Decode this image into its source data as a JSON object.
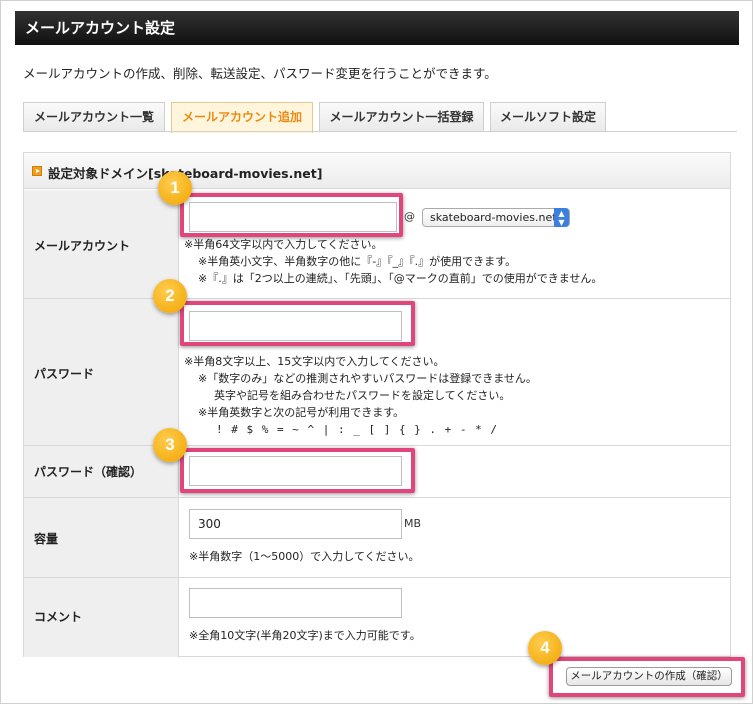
{
  "page": {
    "title": "メールアカウント設定",
    "description": "メールアカウントの作成、削除、転送設定、パスワード変更を行うことができます。"
  },
  "tabs": [
    {
      "label": "メールアカウント一覧",
      "active": false
    },
    {
      "label": "メールアカウント追加",
      "active": true
    },
    {
      "label": "メールアカウント一括登録",
      "active": false
    },
    {
      "label": "メールソフト設定",
      "active": false
    }
  ],
  "panel": {
    "title": "設定対象ドメイン[skateboard-movies.net]"
  },
  "form": {
    "account": {
      "label": "メールアカウント",
      "value": "",
      "at": "@",
      "domain_selected": "skateboard-movies.net",
      "notes": [
        "※半角64文字以内で入力してください。",
        "※半角英小文字、半角数字の他に『-』『_』『.』が使用できます。",
        "※『.』は「2つ以上の連続」、「先頭」、「@マークの直前」での使用ができません。"
      ]
    },
    "password": {
      "label": "パスワード",
      "value": "",
      "notes": [
        "※半角8文字以上、15文字以内で入力してください。",
        "※「数字のみ」などの推測されやすいパスワードは登録できません。",
        "英字や記号を組み合わせたパスワードを設定してください。",
        "※半角英数字と次の記号が利用できます。",
        "! # $ % = ~ ^ | : _ [ ] { } . + - * /"
      ]
    },
    "password_confirm": {
      "label": "パスワード（確認）",
      "value": ""
    },
    "capacity": {
      "label": "容量",
      "value": "300",
      "unit": "MB",
      "note": "※半角数字（1〜5000）で入力してください。"
    },
    "comment": {
      "label": "コメント",
      "value": "",
      "note": "※全角10文字(半角20文字)まで入力可能です。"
    },
    "submit_label": "メールアカウントの作成（確認）"
  },
  "badges": [
    "1",
    "2",
    "3",
    "4"
  ],
  "colors": {
    "highlight": "#e0457b",
    "badge": "#f0a500",
    "active_tab_text": "#e98b12",
    "titlebar": "#1a1a1a"
  }
}
